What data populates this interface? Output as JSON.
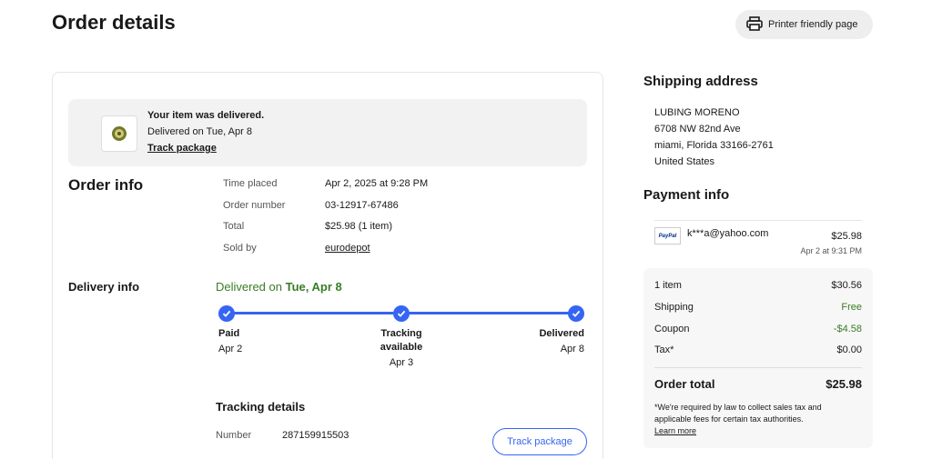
{
  "page": {
    "title": "Order details",
    "printer_label": "Printer friendly page"
  },
  "banner": {
    "heading": "Your item was delivered.",
    "subtext": "Delivered on Tue, Apr 8",
    "track_link": "Track package"
  },
  "order_info": {
    "heading": "Order info",
    "rows": [
      {
        "label": "Time placed",
        "value": "Apr 2, 2025 at 9:28 PM"
      },
      {
        "label": "Order number",
        "value": "03-12917-67486"
      },
      {
        "label": "Total",
        "value": "$25.98 (1 item)"
      },
      {
        "label": "Sold by",
        "value": "eurodepot"
      }
    ]
  },
  "delivery_info": {
    "heading": "Delivery info",
    "status_prefix": "Delivered on ",
    "status_date": "Tue, Apr 8",
    "steps": [
      {
        "label": "Paid",
        "date": "Apr 2"
      },
      {
        "label_line1": "Tracking",
        "label_line2": "available",
        "date": "Apr 3"
      },
      {
        "label": "Delivered",
        "date": "Apr 8"
      }
    ]
  },
  "tracking": {
    "heading": "Tracking details",
    "number_label": "Number",
    "number_value": "287159915503",
    "button_label": "Track package"
  },
  "shipping_address": {
    "heading": "Shipping address",
    "lines": [
      "LUBING MORENO",
      "6708 NW 82nd Ave",
      "miami, Florida 33166-2761",
      "United States"
    ]
  },
  "payment_info": {
    "heading": "Payment info",
    "method_logo": "PayPal",
    "email": "k***a@yahoo.com",
    "amount": "$25.98",
    "timestamp": "Apr 2 at 9:31 PM",
    "summary": [
      {
        "label": "1 item",
        "value": "$30.56"
      },
      {
        "label": "Shipping",
        "value": "Free"
      },
      {
        "label": "Coupon",
        "value": "-$4.58"
      },
      {
        "label": "Tax*",
        "value": "$0.00"
      }
    ],
    "total_label": "Order total",
    "total_value": "$25.98",
    "note_line1": "*We're required by law to collect sales tax and",
    "note_line2": "applicable fees for certain tax authorities.",
    "learn_more": "Learn more"
  },
  "colors": {
    "accent": "#3665f3",
    "success": "#3a7c25",
    "text": "#191919"
  },
  "icons": [
    "printer-icon",
    "check-icon",
    "item-thumbnail",
    "paypal-logo"
  ]
}
